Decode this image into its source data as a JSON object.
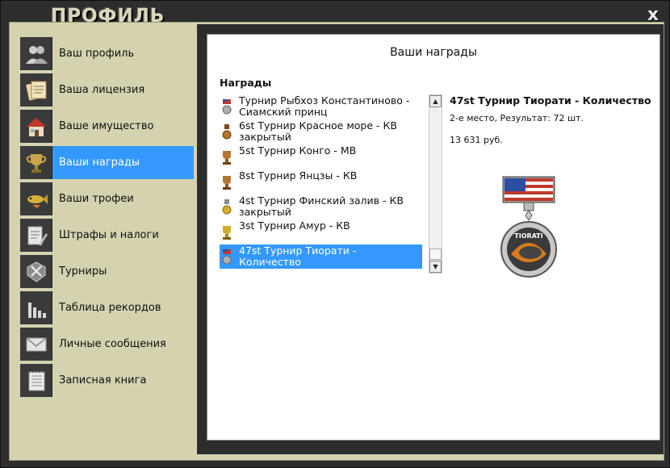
{
  "window": {
    "title": "ПРОФИЛЬ",
    "close_label": "x"
  },
  "nav": {
    "items": [
      {
        "label": "Ваш профиль",
        "icon": "profile-icon"
      },
      {
        "label": "Ваша лицензия",
        "icon": "license-icon"
      },
      {
        "label": "Ваше имущество",
        "icon": "house-icon"
      },
      {
        "label": "Ваши награды",
        "icon": "trophy-icon",
        "active": true
      },
      {
        "label": "Ваши трофеи",
        "icon": "fish-icon"
      },
      {
        "label": "Штрафы и налоги",
        "icon": "fines-icon"
      },
      {
        "label": "Турниры",
        "icon": "tournament-icon"
      },
      {
        "label": "Таблица рекордов",
        "icon": "chart-icon"
      },
      {
        "label": "Личные сообщения",
        "icon": "envelope-icon"
      },
      {
        "label": "Записная книга",
        "icon": "notebook-icon"
      }
    ]
  },
  "content": {
    "title": "Ваши награды",
    "list_header": "Награды",
    "awards": [
      {
        "name": "Турнир Рыбхоз Константиново - Сиамский принц",
        "medal": "flag-medal"
      },
      {
        "name": "6st Турнир Красное море - КВ закрытый",
        "medal": "bronze-medal"
      },
      {
        "name": "5st Турнир Конго - МВ",
        "medal": "bronze-cup"
      },
      {
        "name": "8st Турнир Янцзы - КВ",
        "medal": "bronze-cup"
      },
      {
        "name": "4st Турнир Финский залив - КВ закрытый",
        "medal": "gold-medal"
      },
      {
        "name": "3st Турнир Амур - КВ",
        "medal": "gold-cup"
      },
      {
        "name": "47st Турнир Тиорати - Количество",
        "medal": "flag-medal",
        "selected": true
      }
    ],
    "detail": {
      "title": "47st Турнир Тиорати - Количество",
      "result": "2-е место, Результат: 72 шт.",
      "prize": "13 631 руб.",
      "medal_text": "TIORATI"
    }
  },
  "colors": {
    "accent": "#3399ff",
    "frame": "#d5d2b0",
    "dark": "#2d2d2d"
  }
}
